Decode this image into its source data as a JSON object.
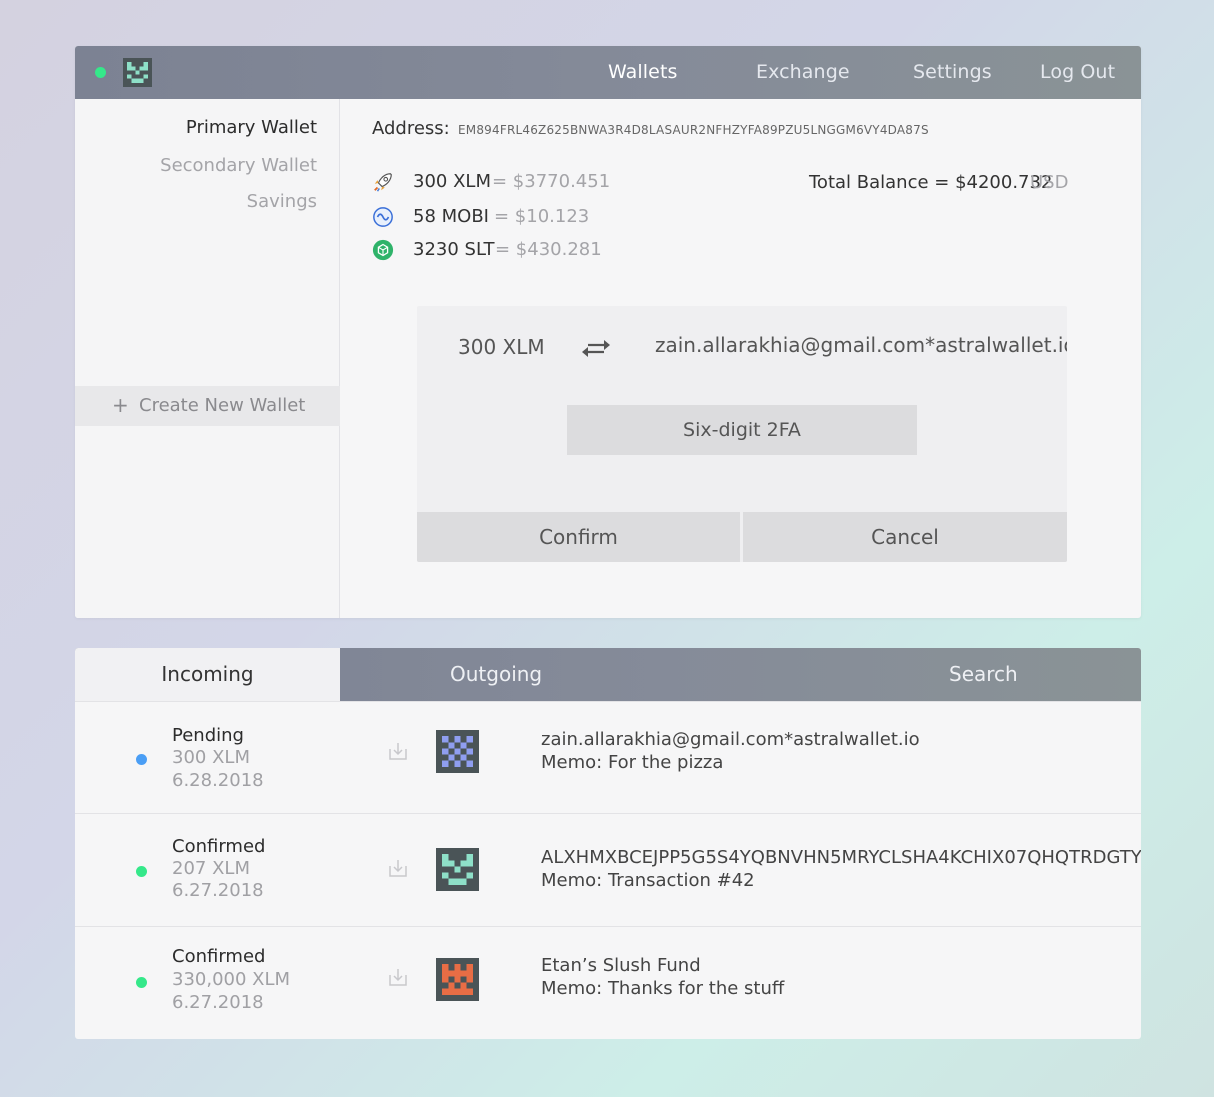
{
  "header": {
    "status": "online",
    "nav": [
      "Wallets",
      "Exchange",
      "Settings",
      "Log Out"
    ],
    "active_nav": "Wallets"
  },
  "sidebar": {
    "wallets": [
      "Primary Wallet",
      "Secondary Wallet",
      "Savings"
    ],
    "active_wallet": "Primary Wallet",
    "create_label": "Create New Wallet",
    "create_icon": "+"
  },
  "wallet": {
    "address_label": "Address:",
    "address": "EM894FRL46Z625BNWA3R4D8LASAUR2NFHZYFA89PZU5LNGGM6VY4DA87S",
    "assets": [
      {
        "icon": "rocket-icon",
        "amount": "300 XLM",
        "usd": "= $3770.451"
      },
      {
        "icon": "mobi-icon",
        "amount": "58 MOBI",
        "usd": "= $10.123"
      },
      {
        "icon": "slt-icon",
        "amount": "3230 SLT",
        "usd": "= $430.281"
      }
    ],
    "total_label": "Total Balance = $4200.732",
    "total_currency": "USD"
  },
  "send": {
    "amount": "300 XLM",
    "recipient": "zain.allarakhia@gmail.com*astralwallet.io",
    "twofa_placeholder": "Six-digit 2FA",
    "confirm_label": "Confirm",
    "cancel_label": "Cancel"
  },
  "transactions": {
    "tabs": [
      "Incoming",
      "Outgoing",
      "Search"
    ],
    "active_tab": "Incoming",
    "items": [
      {
        "status": "Pending",
        "amount": "300 XLM",
        "date": "6.28.2018",
        "counterparty": "zain.allarakhia@gmail.com*astralwallet.io",
        "memo": "Memo: For the pizza",
        "dot_color": "#4a9ef5",
        "avatar": "checker-blue"
      },
      {
        "status": "Confirmed",
        "amount": "207 XLM",
        "date": "6.27.2018",
        "counterparty": "ALXHMXBCEJPP5G5S4YQBNVHN5MRYCLSHA4KCHIX07QHQTRDGTY",
        "memo": "Memo: Transaction #42",
        "dot_color": "#35e88a",
        "avatar": "identicon-teal"
      },
      {
        "status": "Confirmed",
        "amount": "330,000 XLM",
        "date": "6.27.2018",
        "counterparty": "Etan’s Slush Fund",
        "memo": "Memo: Thanks for the stuff",
        "dot_color": "#35e88a",
        "avatar": "identicon-orange"
      }
    ]
  },
  "colors": {
    "accent_green": "#35e88a",
    "pending_blue": "#4a9ef5",
    "header_bg": "#7c8293"
  }
}
